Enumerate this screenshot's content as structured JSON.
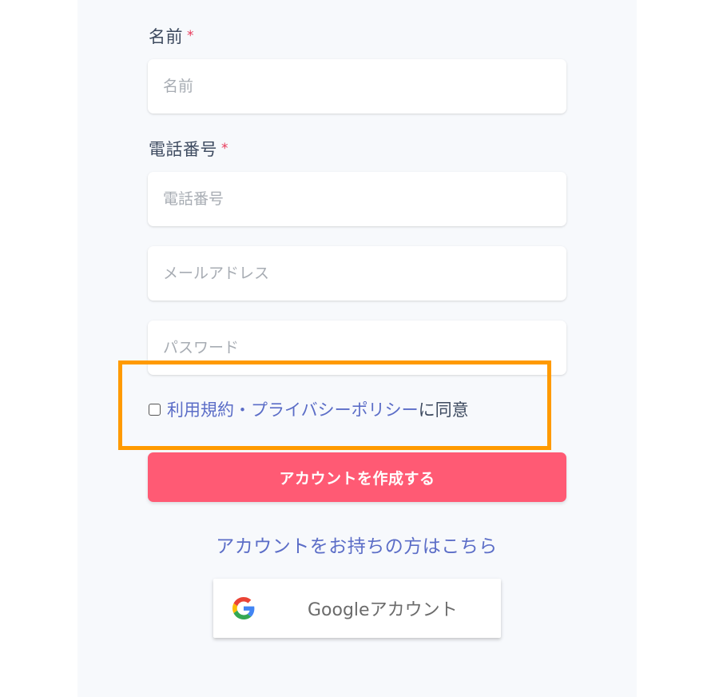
{
  "form": {
    "name": {
      "label": "名前",
      "required_mark": "*",
      "placeholder": "名前",
      "value": ""
    },
    "phone": {
      "label": "電話番号",
      "required_mark": "*",
      "placeholder": "電話番号",
      "value": ""
    },
    "email": {
      "placeholder": "メールアドレス",
      "value": ""
    },
    "password": {
      "placeholder": "パスワード",
      "value": ""
    },
    "terms": {
      "checked": false,
      "link_text": "利用規約・プライバシーポリシー",
      "suffix_text": "に同意"
    },
    "submit_label": "アカウントを作成する"
  },
  "login_link": "アカウントをお持ちの方はこちら",
  "google": {
    "label": "Googleアカウント",
    "icon": "google-icon"
  },
  "colors": {
    "accent": "#ff5a74",
    "link": "#5b6dc7",
    "required": "#e8395a",
    "highlight": "#ff9a00",
    "panel_bg": "#f7f9fc"
  }
}
